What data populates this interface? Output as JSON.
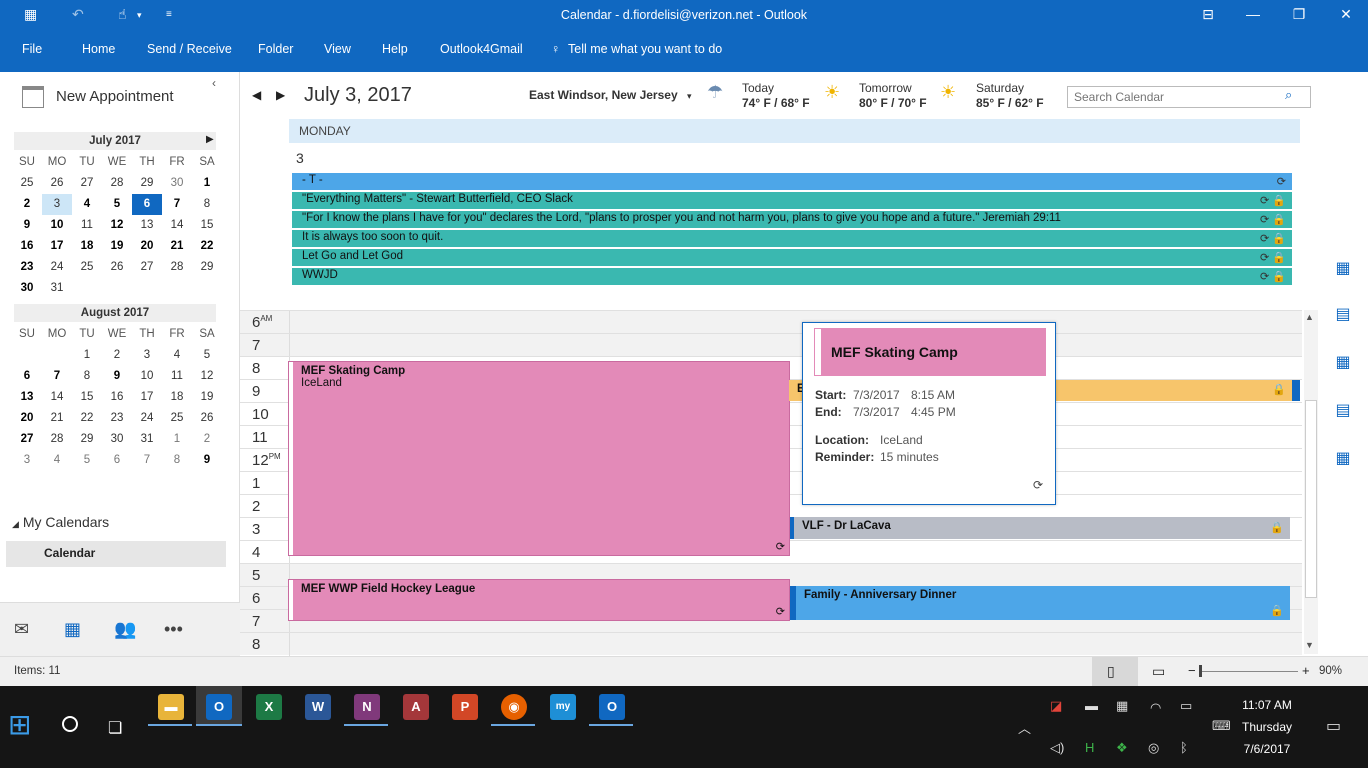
{
  "window": {
    "title": "Calendar - d.fiordelisi@verizon.net - Outlook",
    "menu": [
      "File",
      "Home",
      "Send / Receive",
      "Folder",
      "View",
      "Help",
      "Outlook4Gmail"
    ],
    "tell_me": "Tell me what you want to do"
  },
  "left": {
    "new_appointment": "New Appointment",
    "months": [
      {
        "name": "July 2017",
        "dow": [
          "SU",
          "MO",
          "TU",
          "WE",
          "TH",
          "FR",
          "SA"
        ],
        "weeks": [
          [
            "25",
            "26",
            "27",
            "28",
            "29",
            "30",
            "1"
          ],
          [
            "2",
            "3",
            "4",
            "5",
            "6",
            "7",
            "8"
          ],
          [
            "9",
            "10",
            "11",
            "12",
            "13",
            "14",
            "15"
          ],
          [
            "16",
            "17",
            "18",
            "19",
            "20",
            "21",
            "22"
          ],
          [
            "23",
            "24",
            "25",
            "26",
            "27",
            "28",
            "29"
          ],
          [
            "30",
            "31",
            "",
            "",
            "",
            "",
            ""
          ]
        ]
      },
      {
        "name": "August 2017",
        "dow": [
          "SU",
          "MO",
          "TU",
          "WE",
          "TH",
          "FR",
          "SA"
        ],
        "weeks": [
          [
            "",
            "",
            "1",
            "2",
            "3",
            "4",
            "5"
          ],
          [
            "6",
            "7",
            "8",
            "9",
            "10",
            "11",
            "12"
          ],
          [
            "13",
            "14",
            "15",
            "16",
            "17",
            "18",
            "19"
          ],
          [
            "20",
            "21",
            "22",
            "23",
            "24",
            "25",
            "26"
          ],
          [
            "27",
            "28",
            "29",
            "30",
            "31",
            "1",
            "2"
          ],
          [
            "3",
            "4",
            "5",
            "6",
            "7",
            "8",
            "9"
          ]
        ]
      }
    ],
    "my_calendars": "My Calendars",
    "calendar_item": "Calendar"
  },
  "header": {
    "date": "July 3, 2017",
    "location": "East Windsor, New Jersey",
    "weather": [
      {
        "label": "Today",
        "temp": "74° F / 68° F",
        "icon": "rain-cloud-icon"
      },
      {
        "label": "Tomorrow",
        "temp": "80° F / 70° F",
        "icon": "partly-sunny-icon"
      },
      {
        "label": "Saturday",
        "temp": "85° F / 62° F",
        "icon": "partly-sunny-icon"
      }
    ],
    "search_placeholder": "Search Calendar"
  },
  "day": {
    "name": "MONDAY",
    "number": "3",
    "all_day": [
      {
        "text": "- T -",
        "color": "#4da6e8"
      },
      {
        "text": "\"Everything Matters\" - Stewart Butterfield, CEO Slack",
        "color": "#3ab8b0"
      },
      {
        "text": "\"For I know the plans I have for you\" declares the Lord, \"plans to prosper you and not harm you, plans to give you hope and a future.\" Jeremiah 29:11",
        "color": "#3ab8b0"
      },
      {
        "text": "It is always too soon to quit.",
        "color": "#3ab8b0"
      },
      {
        "text": "Let Go and Let God",
        "color": "#3ab8b0"
      },
      {
        "text": "WWJD",
        "color": "#3ab8b0"
      }
    ],
    "hours": [
      {
        "h": "6",
        "ampm": "AM"
      },
      {
        "h": "7",
        "ampm": ""
      },
      {
        "h": "8",
        "ampm": ""
      },
      {
        "h": "9",
        "ampm": ""
      },
      {
        "h": "10",
        "ampm": ""
      },
      {
        "h": "11",
        "ampm": ""
      },
      {
        "h": "12",
        "ampm": "PM"
      },
      {
        "h": "1",
        "ampm": ""
      },
      {
        "h": "2",
        "ampm": ""
      },
      {
        "h": "3",
        "ampm": ""
      },
      {
        "h": "4",
        "ampm": ""
      },
      {
        "h": "5",
        "ampm": ""
      },
      {
        "h": "6",
        "ampm": ""
      },
      {
        "h": "7",
        "ampm": ""
      },
      {
        "h": "8",
        "ampm": ""
      }
    ],
    "appointments": {
      "skating": {
        "title": "MEF Skating Camp",
        "location": "IceLand"
      },
      "hockey": {
        "title": "MEF WWP Field Hockey League"
      },
      "orange_label": "E",
      "vlf": {
        "title": "VLF - Dr LaCava"
      },
      "family": {
        "title": "Family - Anniversary Dinner"
      }
    }
  },
  "peek": {
    "title": "MEF Skating Camp",
    "start_label": "Start:",
    "start_date": "7/3/2017",
    "start_time": "8:15 AM",
    "end_label": "End:",
    "end_date": "7/3/2017",
    "end_time": "4:45 PM",
    "location_label": "Location:",
    "location": "IceLand",
    "reminder_label": "Reminder:",
    "reminder": "15 minutes"
  },
  "status": {
    "items": "Items: 11",
    "zoom": "90%"
  },
  "taskbar": {
    "apps": [
      "file-explorer",
      "outlook",
      "excel",
      "word",
      "onenote",
      "access",
      "powerpoint",
      "firefox",
      "mywork",
      "outlook-alt"
    ],
    "time": "11:07 AM",
    "day": "Thursday",
    "date": "7/6/2017"
  },
  "colors": {
    "accent": "#1068c1",
    "skating": "#e38ab8",
    "orange": "#f7c56b",
    "grey_event": "#b8bcc6",
    "family": "#4da6e8",
    "teal": "#3ab8b0"
  }
}
